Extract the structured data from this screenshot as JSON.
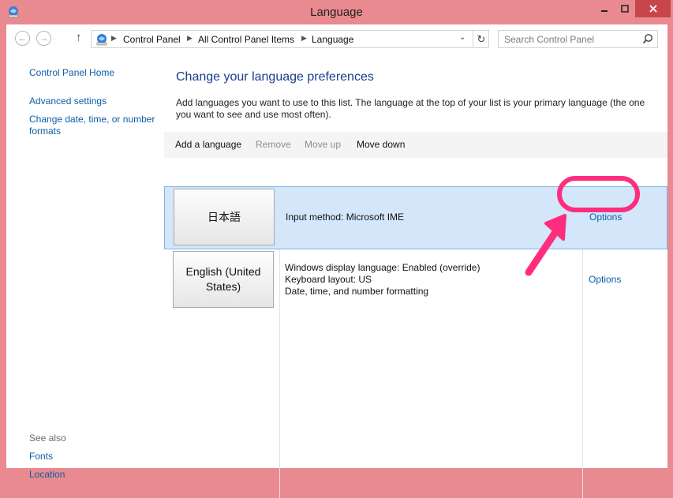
{
  "window": {
    "title": "Language"
  },
  "address": {
    "crumbs": [
      "Control Panel",
      "All Control Panel Items",
      "Language"
    ]
  },
  "search": {
    "placeholder": "Search Control Panel"
  },
  "leftnav": {
    "home": "Control Panel Home",
    "advanced": "Advanced settings",
    "change_date_line1": "Change date, time, or number",
    "change_date_line2": "formats",
    "see_also": "See also",
    "fonts": "Fonts",
    "location": "Location"
  },
  "main": {
    "heading": "Change your language preferences",
    "description": "Add languages you want to use to this list. The language at the top of your list is your primary language (the one you want to see and use most often)."
  },
  "toolbar": {
    "add": "Add a language",
    "remove": "Remove",
    "move_up": "Move up",
    "move_down": "Move down"
  },
  "languages": [
    {
      "name": "日本語",
      "info": [
        "Input method: Microsoft IME"
      ],
      "options": "Options",
      "selected": true
    },
    {
      "name": "English (United States)",
      "info": [
        "Windows display language: Enabled (override)",
        "Keyboard layout: US",
        "Date, time, and number formatting"
      ],
      "options": "Options",
      "selected": false
    }
  ],
  "colors": {
    "frame": "#e88a8f",
    "close": "#c7464a",
    "link": "#0b5ea8",
    "heading": "#1a3e8c",
    "selected_row": "#d3e6fa",
    "highlight": "#ff2d7e"
  },
  "icons": {
    "app": "control-panel-icon",
    "back": "back-arrow-icon",
    "forward": "forward-arrow-icon",
    "up": "up-arrow-icon",
    "refresh": "refresh-icon",
    "search": "search-icon"
  }
}
